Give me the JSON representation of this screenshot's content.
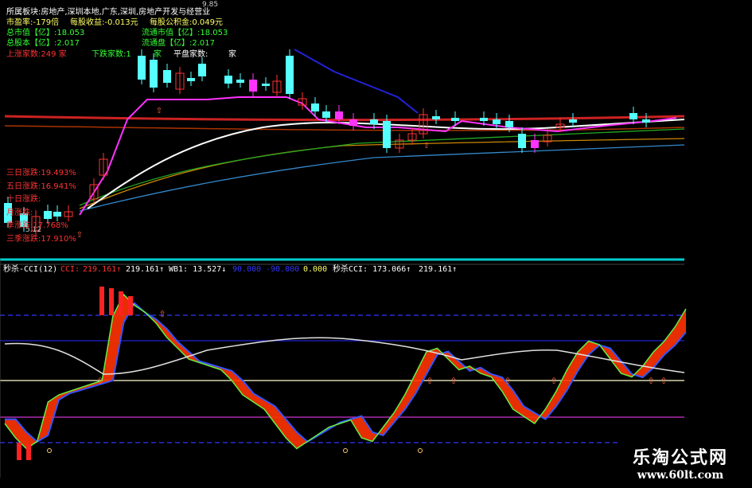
{
  "info": {
    "sector_line": "所属板块:房地产,深圳本地,广东,深圳,房地产开发与经营业",
    "pe": "市盈率:-179倍",
    "eps": "每股收益:-0.013元",
    "nav": "每股公积金:0.049元",
    "total_mv": "总市值【亿】:18.053",
    "float_mv": "流通市值【亿】:18.053",
    "total_shares": "总股本【亿】:2.017",
    "float_shares": "流通盘【亿】:2.017",
    "up_count": "上涨家数:249 家",
    "down_count": "下跌家数:1",
    "down_unit": "家",
    "flat_count": "平盘家数:",
    "flat_unit": "家",
    "price_high": "9.85",
    "price_low": "5.12",
    "stats": [
      {
        "label": "三日涨跌:19.493%",
        "color": "#ff3333"
      },
      {
        "label": "五日涨跌:16.941%",
        "color": "#ff3333"
      },
      {
        "label": "十日涨跌:",
        "color": "#ff3333"
      },
      {
        "label": "月涨跌:",
        "color": "#ff3333"
      },
      {
        "label": "季涨跌:17.768%",
        "color": "#ff3333"
      },
      {
        "label": "三季涨跌:17.910%",
        "color": "#ff3333"
      }
    ]
  },
  "indicator": {
    "name": "秒杀-CCI(12)",
    "cci_label": "CCI:",
    "cci_val": "219.161↑",
    "v2": "219.161↑",
    "wb1": "WB1: 13.527↓",
    "l1": "90.000",
    "l2": "-90.000",
    "l3": "0.000",
    "mscci": "秒杀CCI: 173.066↑",
    "v5": "219.161↑"
  },
  "watermark": {
    "title": "乐淘公式网",
    "url": "www.60lt.com"
  },
  "colors": {
    "background": "#000000",
    "up": "#ff3333",
    "down": "#55ffff",
    "ma_white": "#ffffff",
    "ma_magenta": "#ff33ff",
    "ma_blue": "#2222dd",
    "cci_fill": "#ff3300"
  },
  "chart_data": {
    "type": "line",
    "series": [
      {
        "name": "CCI",
        "values": [
          -120,
          -160,
          -190,
          -170,
          -60,
          -40,
          -30,
          -20,
          -10,
          0,
          180,
          240,
          210,
          190,
          160,
          120,
          90,
          60,
          50,
          40,
          30,
          0,
          -40,
          -60,
          -80,
          -120,
          -160,
          -190,
          -170,
          -150,
          -130,
          -120,
          -110,
          -160,
          -170,
          -130,
          -90,
          -40,
          20,
          80,
          90,
          60,
          30,
          40,
          20,
          10,
          -30,
          -80,
          -100,
          -120,
          -80,
          -30,
          30,
          80,
          110,
          100,
          60,
          20,
          10,
          40,
          80,
          110,
          150,
          200
        ]
      }
    ]
  }
}
